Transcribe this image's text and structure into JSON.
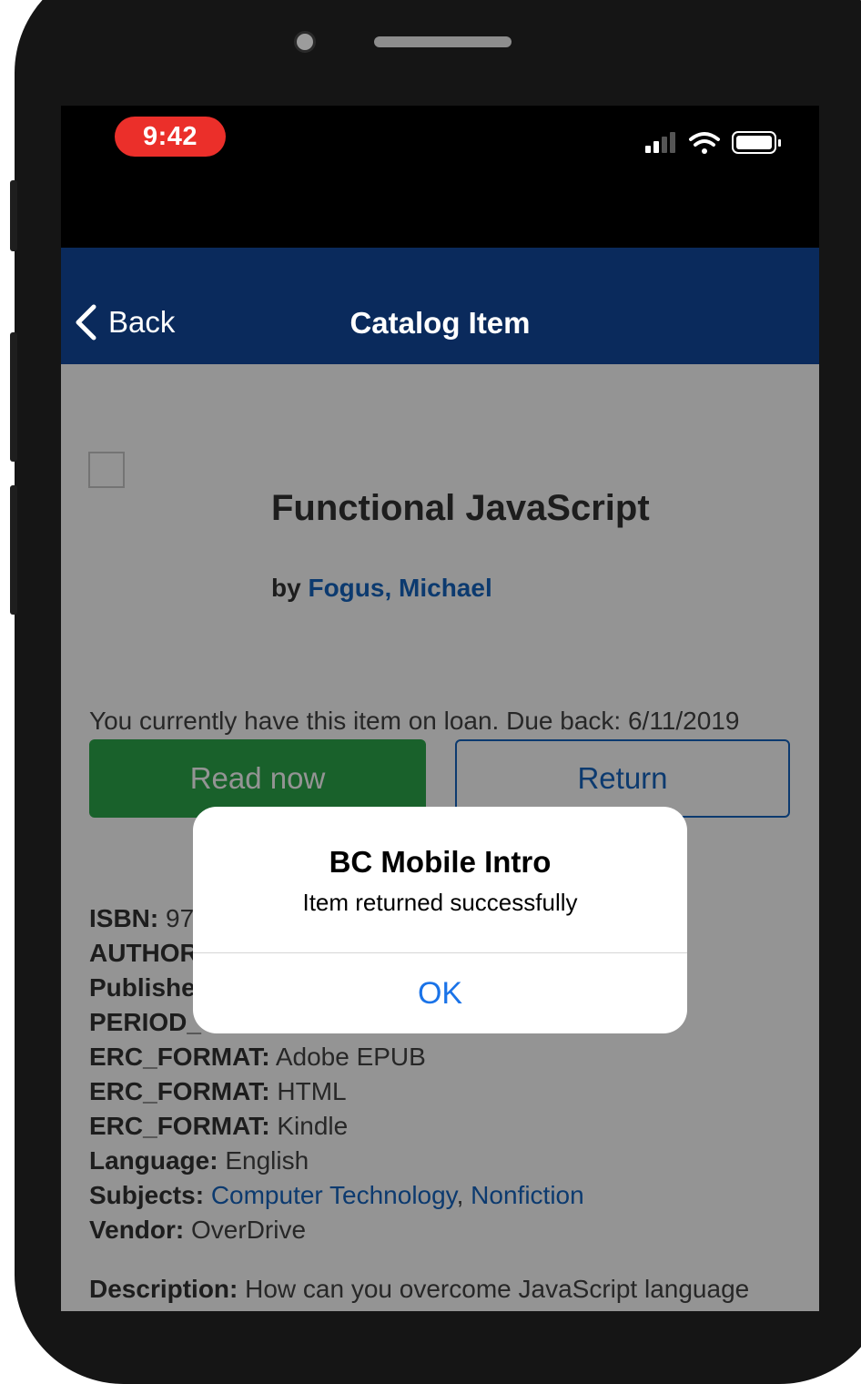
{
  "status_bar": {
    "time": "9:42"
  },
  "navbar": {
    "back_label": "Back",
    "title": "Catalog Item"
  },
  "item": {
    "title": "Functional JavaScript",
    "by_prefix": "by",
    "author": "Fogus, Michael",
    "loan_message": "You currently have this item on loan. Due back: 6/11/2019",
    "read_now_label": "Read now",
    "return_label": "Return"
  },
  "metadata": [
    {
      "key": "ISBN:",
      "value": "97"
    },
    {
      "key": "AUTHOR",
      "value": ""
    },
    {
      "key": "Publishe",
      "value": ""
    },
    {
      "key": "PERIOD_",
      "value": ""
    },
    {
      "key": "ERC_FORMAT:",
      "value": "Adobe EPUB"
    },
    {
      "key": "ERC_FORMAT:",
      "value": "HTML"
    },
    {
      "key": "ERC_FORMAT:",
      "value": "Kindle"
    },
    {
      "key": "Language:",
      "value": "English"
    }
  ],
  "subjects": {
    "key": "Subjects:",
    "items": [
      "Computer Technology",
      "Nonfiction"
    ],
    "separator": ","
  },
  "vendor": {
    "key": "Vendor:",
    "value": "OverDrive"
  },
  "description": {
    "key": "Description:",
    "value": "How can you overcome JavaScript language"
  },
  "alert": {
    "title": "BC Mobile Intro",
    "message": "Item returned successfully",
    "ok_label": "OK"
  },
  "colors": {
    "navbar": "#0a2a5c",
    "time_pill": "#eb2f2a",
    "read_button": "#2ba84a",
    "link": "#1565c0",
    "alert_button": "#1a73e8"
  },
  "icons": [
    "back-chevron-icon",
    "cellular-signal-icon",
    "wifi-icon",
    "battery-icon"
  ]
}
